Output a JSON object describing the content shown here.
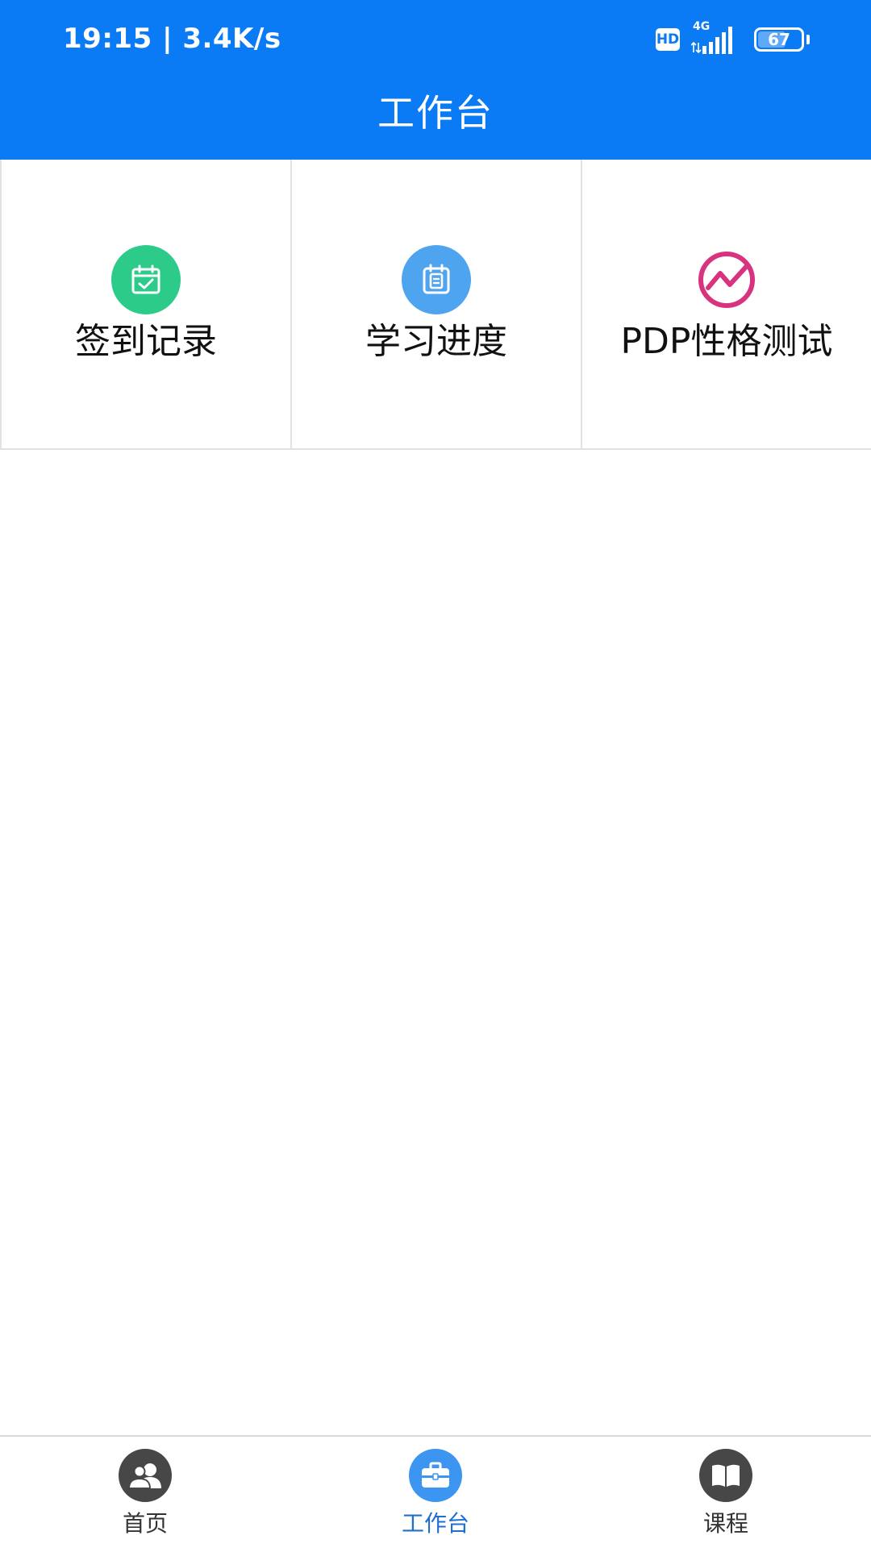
{
  "status_bar": {
    "time_speed": "19:15 | 3.4K/s",
    "hd_badge": "HD",
    "network": "4G",
    "battery": "67",
    "battery_level_percent": 67
  },
  "header": {
    "title": "工作台"
  },
  "grid": {
    "items": [
      {
        "label": "签到记录",
        "icon": "calendar-check-icon",
        "icon_color": "#2ccb8a"
      },
      {
        "label": "学习进度",
        "icon": "notebook-icon",
        "icon_color": "#4ea4ee"
      },
      {
        "label": "PDP性格测试",
        "icon": "trend-chart-icon",
        "icon_color": "#d8337e"
      }
    ]
  },
  "tabbar": {
    "items": [
      {
        "label": "首页",
        "icon": "users-icon",
        "active": false
      },
      {
        "label": "工作台",
        "icon": "briefcase-icon",
        "active": true
      },
      {
        "label": "课程",
        "icon": "book-icon",
        "active": false
      }
    ]
  },
  "colors": {
    "header_bg": "#0a7bf5",
    "tab_active": "#3d95f2",
    "tab_inactive": "#474747"
  }
}
